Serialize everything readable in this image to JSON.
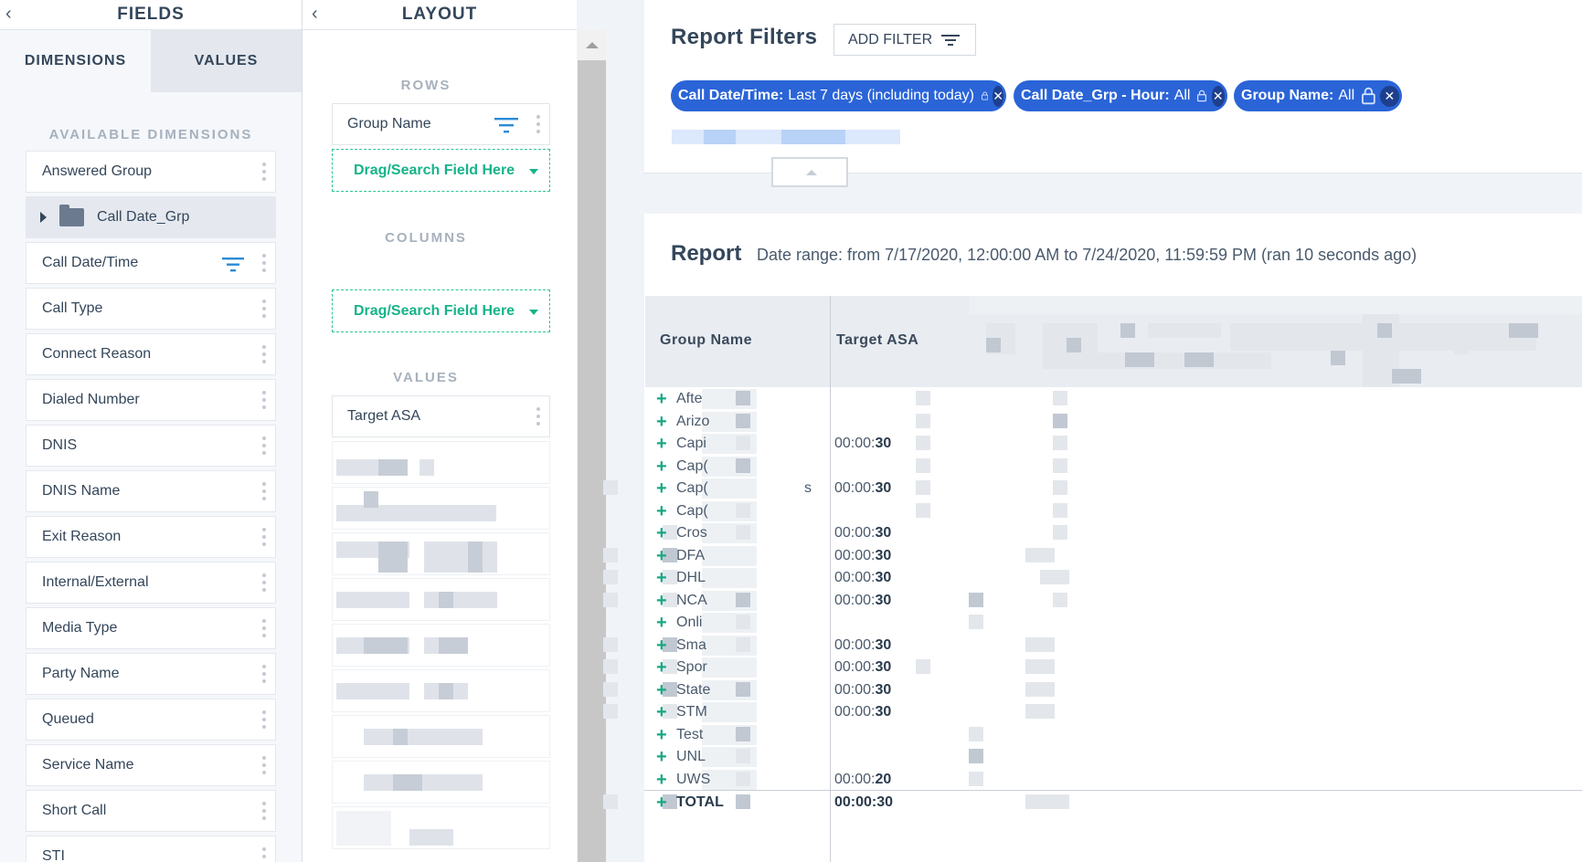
{
  "fields_panel": {
    "title": "FIELDS",
    "tabs": [
      "DIMENSIONS",
      "VALUES"
    ],
    "section_label": "AVAILABLE DIMENSIONS",
    "items": [
      {
        "label": "Answered Group",
        "type": "field"
      },
      {
        "label": "Call Date_Grp",
        "type": "group"
      },
      {
        "label": "Call Date/Time",
        "type": "field",
        "filtered": true
      },
      {
        "label": "Call Type",
        "type": "field"
      },
      {
        "label": "Connect Reason",
        "type": "field"
      },
      {
        "label": "Dialed Number",
        "type": "field"
      },
      {
        "label": "DNIS",
        "type": "field"
      },
      {
        "label": "DNIS Name",
        "type": "field"
      },
      {
        "label": "Exit Reason",
        "type": "field"
      },
      {
        "label": "Internal/External",
        "type": "field"
      },
      {
        "label": "Media Type",
        "type": "field"
      },
      {
        "label": "Party Name",
        "type": "field"
      },
      {
        "label": "Queued",
        "type": "field"
      },
      {
        "label": "Service Name",
        "type": "field"
      },
      {
        "label": "Short Call",
        "type": "field"
      },
      {
        "label": "STI",
        "type": "field"
      }
    ]
  },
  "layout_panel": {
    "title": "LAYOUT",
    "rows_label": "ROWS",
    "rows_field": "Group Name",
    "drop_placeholder": "Drag/Search Field Here",
    "columns_label": "COLUMNS",
    "values_label": "VALUES",
    "values_field": "Target ASA"
  },
  "filters": {
    "title": "Report Filters",
    "add_button": "ADD FILTER",
    "chips": [
      {
        "key": "Call Date/Time:",
        "value": "Last 7 days (including today)"
      },
      {
        "key": "Call Date_Grp - Hour:",
        "value": "All"
      },
      {
        "key": "Group Name:",
        "value": "All"
      }
    ]
  },
  "report": {
    "title": "Report",
    "range": "Date range: from 7/17/2020, 12:00:00 AM to 7/24/2020, 11:59:59 PM (ran 10 seconds ago)",
    "columns": [
      "Group Name",
      "Target ASA"
    ],
    "rows": [
      {
        "name": "Afte",
        "prefix": "",
        "value": ""
      },
      {
        "name": "Arizo",
        "prefix": "",
        "value": ""
      },
      {
        "name": "Capi",
        "prefix": "00:00:",
        "value": "30"
      },
      {
        "name": "Cap(",
        "prefix": "",
        "value": ""
      },
      {
        "name": "Cap(",
        "prefix": "00:00:",
        "value": "30",
        "suffix": "s"
      },
      {
        "name": "Cap(",
        "prefix": "",
        "value": ""
      },
      {
        "name": "Cros",
        "prefix": "00:00:",
        "value": "30"
      },
      {
        "name": "DFA",
        "prefix": "00:00:",
        "value": "30"
      },
      {
        "name": "DHL",
        "prefix": "00:00:",
        "value": "30"
      },
      {
        "name": "NCA",
        "prefix": "00:00:",
        "value": "30"
      },
      {
        "name": "Onli",
        "prefix": "",
        "value": ""
      },
      {
        "name": "Sma",
        "prefix": "00:00:",
        "value": "30"
      },
      {
        "name": "Spor",
        "prefix": "00:00:",
        "value": "30"
      },
      {
        "name": "State",
        "prefix": "00:00:",
        "value": "30"
      },
      {
        "name": "STM",
        "prefix": "00:00:",
        "value": "30"
      },
      {
        "name": "Test",
        "prefix": "",
        "value": ""
      },
      {
        "name": "UNL",
        "prefix": "",
        "value": ""
      },
      {
        "name": "UWS",
        "prefix": "00:00:",
        "value": "20"
      }
    ],
    "total": {
      "name": "TOTAL",
      "value": "00:00:30"
    }
  },
  "colors": {
    "accent": "#2a64d7",
    "chip_x": "#1e3f8e",
    "drop": "#16b489",
    "plus": "#18a883",
    "filter_icon": "#2a8bd7"
  }
}
